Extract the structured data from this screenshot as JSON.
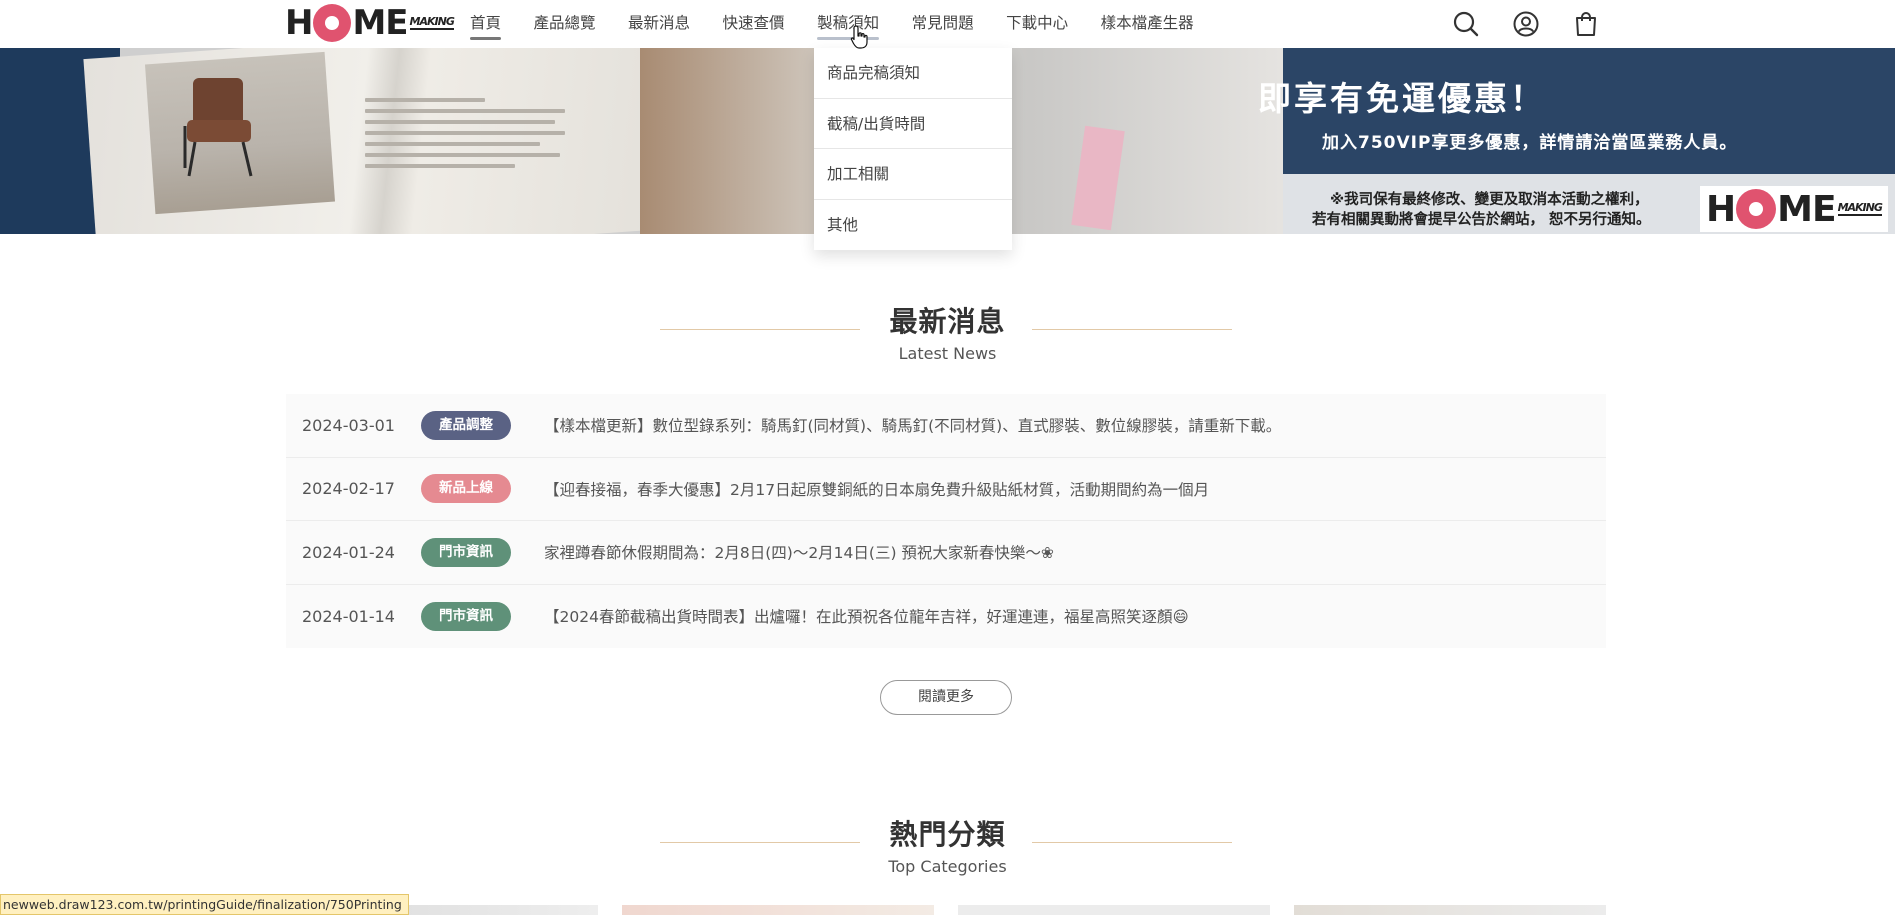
{
  "header": {
    "logo": {
      "letters_left": "H",
      "letters_right": "ME",
      "sub": "MAKING"
    },
    "nav": [
      {
        "label": "首頁",
        "state": "active"
      },
      {
        "label": "產品總覽"
      },
      {
        "label": "最新消息"
      },
      {
        "label": "快速查價"
      },
      {
        "label": "製稿須知",
        "state": "hover"
      },
      {
        "label": "常見問題"
      },
      {
        "label": "下載中心"
      },
      {
        "label": "樣本檔產生器"
      }
    ],
    "icons": [
      "search-icon",
      "account-icon",
      "cart-icon"
    ]
  },
  "banner": {
    "headline": "即享有免運優惠！",
    "subline": "加入750VIP享更多優惠，詳情請洽當區業務人員。",
    "note_line1": "※我司保有最終修改、變更及取消本活動之權利，",
    "note_line2": "若有相關異動將會提早公告於網站， 恕不另行通知。"
  },
  "dropdown": {
    "items": [
      "商品完稿須知",
      "截稿/出貨時間",
      "加工相關",
      "其他"
    ]
  },
  "news_section": {
    "title": "最新消息",
    "subtitle": "Latest News",
    "items": [
      {
        "date": "2024-03-01",
        "badge": "產品調整",
        "badge_color": "#5a6284",
        "text": "【樣本檔更新】數位型錄系列：騎馬釘(同材質)、騎馬釘(不同材質)、直式膠裝、數位線膠裝，請重新下載。"
      },
      {
        "date": "2024-02-17",
        "badge": "新品上線",
        "badge_color": "#e58a91",
        "text": "【迎春接福，春季大優惠】2月17日起原雙銅紙的日本扇免費升級貼紙材質，活動期間約為一個月"
      },
      {
        "date": "2024-01-24",
        "badge": "門市資訊",
        "badge_color": "#5f9179",
        "text": "家裡蹲春節休假期間為：2月8日(四)～2月14日(三) 預祝大家新春快樂～❀"
      },
      {
        "date": "2024-01-14",
        "badge": "門市資訊",
        "badge_color": "#5f9179",
        "text": "【2024春節截稿出貨時間表】出爐囉！在此預祝各位龍年吉祥，好運連連，福星高照笑逐顏😄"
      }
    ],
    "more_label": "閱讀更多"
  },
  "categories_section": {
    "title": "熱門分類",
    "subtitle": "Top Categories"
  },
  "status_bar": {
    "url": "newweb.draw123.com.tw/printingGuide/finalization/750Printing"
  }
}
